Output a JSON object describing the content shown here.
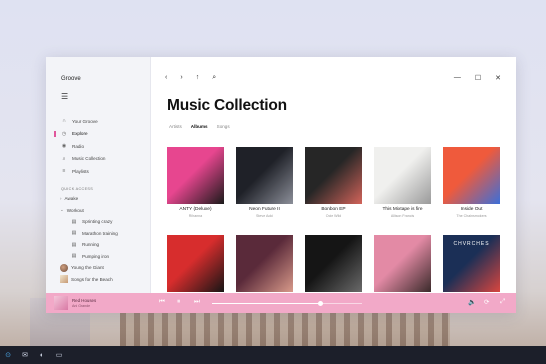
{
  "app": {
    "name": "Groove",
    "menu_icon": "hamburger-icon"
  },
  "sidebar": {
    "items": [
      {
        "label": "Your Groove",
        "icon": "headphones-icon",
        "active": false
      },
      {
        "label": "Explore",
        "icon": "clock-icon",
        "active": true
      },
      {
        "label": "Radio",
        "icon": "radio-icon",
        "active": false
      },
      {
        "label": "Music Collection",
        "icon": "collection-icon",
        "active": false
      },
      {
        "label": "Playlists",
        "icon": "playlist-icon",
        "active": false
      }
    ],
    "quick_access_label": "QUICK ACCESS",
    "quick_access": [
      {
        "label": "Awake",
        "kind": "folder"
      },
      {
        "label": "Workout",
        "kind": "folder-expanded"
      },
      {
        "label": "Sprinting crazy",
        "kind": "playlist"
      },
      {
        "label": "Marathon training",
        "kind": "playlist"
      },
      {
        "label": "Running",
        "kind": "playlist"
      },
      {
        "label": "Pumping iron",
        "kind": "playlist"
      },
      {
        "label": "Young the Giant",
        "kind": "artist"
      },
      {
        "label": "Songs for the Beach",
        "kind": "album"
      }
    ]
  },
  "toolbar": {
    "back": "‹",
    "forward": "›",
    "up": "↑",
    "search": "⌕"
  },
  "window_controls": {
    "minimize": "—",
    "maximize": "☐",
    "close": "✕"
  },
  "page": {
    "title": "Music Collection",
    "tabs": [
      {
        "label": "Artists",
        "selected": false
      },
      {
        "label": "Albums",
        "selected": true
      },
      {
        "label": "Songs",
        "selected": false
      }
    ]
  },
  "albums_row1": [
    {
      "title": "ANTY (Deluxe)",
      "artist": "Rihanna",
      "colors": [
        "#e7468f",
        "#1a1a1a"
      ]
    },
    {
      "title": "Neon Future II",
      "artist": "Steve Aoki",
      "colors": [
        "#1f2128",
        "#8c8f99"
      ]
    },
    {
      "title": "Bonbon EP",
      "artist": "Ocie Wild",
      "colors": [
        "#262626",
        "#d2645a"
      ]
    },
    {
      "title": "This Mixtape is fire",
      "artist": "Allison Francis",
      "colors": [
        "#f0f0ee",
        "#9a9a9a"
      ]
    },
    {
      "title": "Inside Out",
      "artist": "The Chainsmokers",
      "colors": [
        "#ef5a3c",
        "#3b6fd9"
      ]
    }
  ],
  "albums_row2": [
    {
      "colors": [
        "#d72d2d",
        "#151515"
      ]
    },
    {
      "colors": [
        "#5a2a3a",
        "#d89a8a"
      ]
    },
    {
      "colors": [
        "#151515",
        "#6a6a6a"
      ]
    },
    {
      "colors": [
        "#e38aa5",
        "#3a2a2a"
      ]
    },
    {
      "colors": [
        "#1b2f56",
        "#d8463f"
      ]
    }
  ],
  "album_row2_text": {
    "last_cover_text": "CHVRCHES"
  },
  "player": {
    "title": "Red Houses",
    "artist": "Ani Grande",
    "progress": 0.72,
    "accent": "#f2a9c8"
  },
  "taskbar": {
    "icons": [
      "start-icon",
      "mail-icon",
      "edge-icon",
      "explorer-icon"
    ]
  }
}
